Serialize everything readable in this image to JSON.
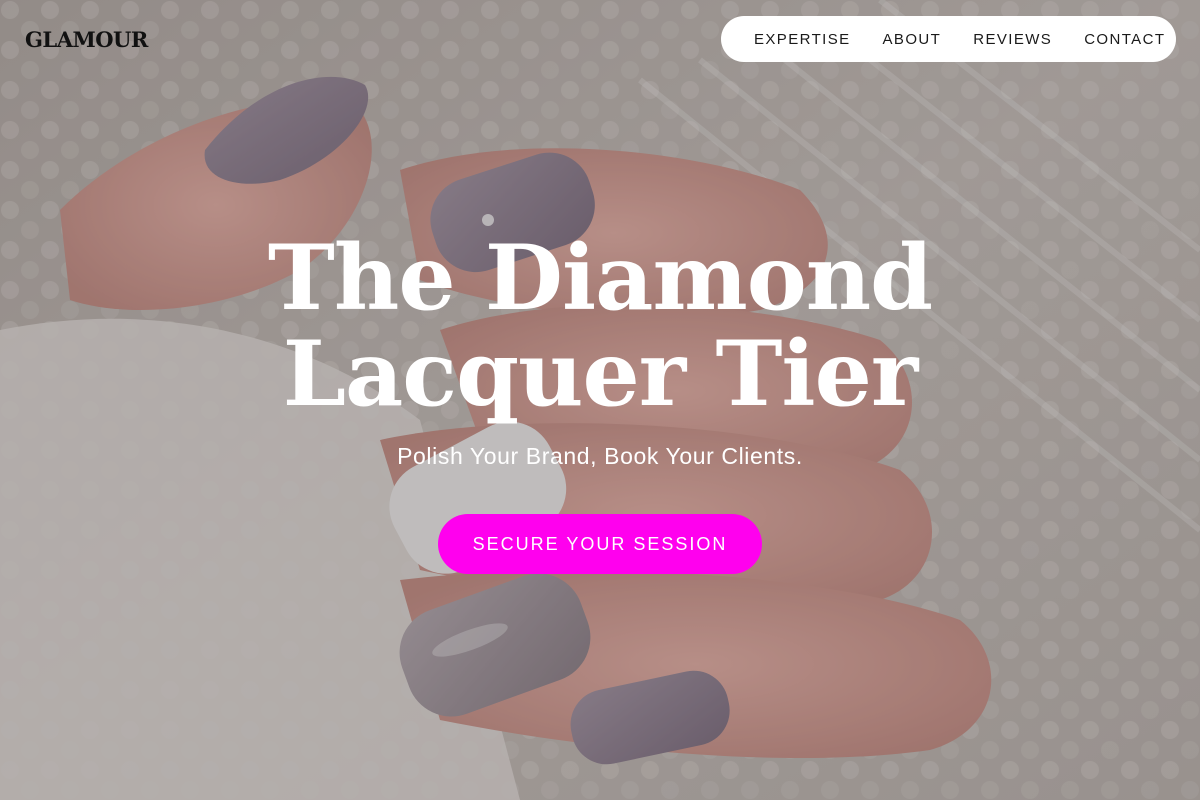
{
  "brand": {
    "logo_text": "GLAMOUR"
  },
  "nav": {
    "items": [
      {
        "label": "EXPERTISE"
      },
      {
        "label": "ABOUT"
      },
      {
        "label": "REVIEWS"
      },
      {
        "label": "CONTACT"
      }
    ]
  },
  "hero": {
    "headline_line1": "The Diamond",
    "headline_line2": "Lacquer Tier",
    "subheadline": "Polish Your Brand, Book Your Clients.",
    "cta_label": "SECURE YOUR SESSION",
    "background_image": "manicured-hand-on-knit-fabric",
    "accent_color": "#ff00ee"
  }
}
